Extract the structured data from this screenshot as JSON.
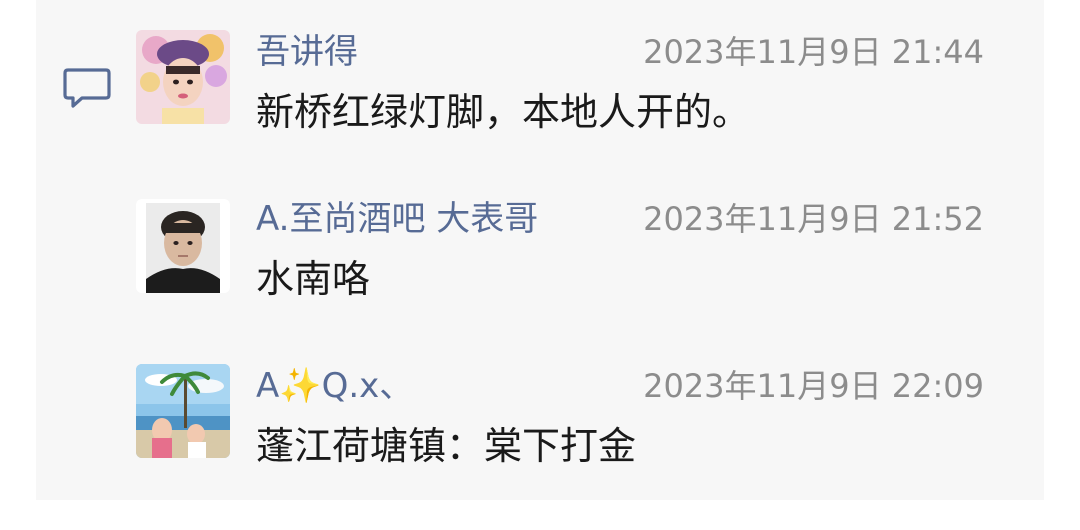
{
  "comments": [
    {
      "name": "吾讲得",
      "time": "2023年11月9日 21:44",
      "content": "新桥红绿灯脚，本地人开的。"
    },
    {
      "name": "A.至尚酒吧  大表哥",
      "time": "2023年11月9日 21:52",
      "content": "水南咯"
    },
    {
      "name": "A✨Q.x、",
      "time": "2023年11月9日 22:09",
      "content": "蓬江荷塘镇：棠下打金"
    }
  ],
  "icons": {
    "comment": "speech-bubble-icon"
  },
  "colors": {
    "name": "#576b95",
    "time": "#8c8c8c",
    "content": "#1a1a1a",
    "panel": "#f7f7f7"
  }
}
